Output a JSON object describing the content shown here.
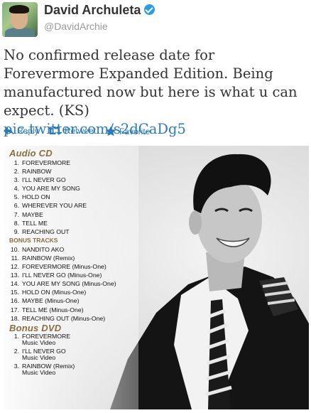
{
  "user": {
    "display_name": "David Archuleta",
    "handle": "@DavidArchie",
    "verified": true
  },
  "tweet": {
    "text": "No confirmed release date for Forevermore Expanded Edition. Being manufactured now but here is what u can expect. (KS)",
    "link": "pic.twitter.com/s2dCaDg5",
    "link_color": "#2b7bb9"
  },
  "actions": {
    "reply": "Reply",
    "retweet": "Retweet",
    "favorite": "Favorite"
  },
  "photo": {
    "audio_cd_title": "Audio CD",
    "audio_tracks": [
      {
        "num": "1.",
        "title": "FOREVERMORE"
      },
      {
        "num": "2.",
        "title": "RAINBOW"
      },
      {
        "num": "3.",
        "title": "I'LL NEVER GO"
      },
      {
        "num": "4.",
        "title": "YOU ARE MY SONG"
      },
      {
        "num": "5.",
        "title": "HOLD ON"
      },
      {
        "num": "6.",
        "title": "WHEREVER YOU ARE"
      },
      {
        "num": "7.",
        "title": "MAYBE"
      },
      {
        "num": "8.",
        "title": "TELL ME"
      },
      {
        "num": "9.",
        "title": "REACHING OUT"
      }
    ],
    "bonus_tracks_title": "BONUS TRACKS",
    "bonus_tracks": [
      {
        "num": "10.",
        "title": "NANDITO AKO"
      },
      {
        "num": "11.",
        "title": "RAINBOW (Remix)"
      },
      {
        "num": "12.",
        "title": "FOREVERMORE (Minus-One)"
      },
      {
        "num": "13.",
        "title": "I'LL NEVER GO (Minus-One)"
      },
      {
        "num": "14.",
        "title": "YOU ARE MY SONG (Minus-One)"
      },
      {
        "num": "15.",
        "title": "HOLD ON (Minus-One)"
      },
      {
        "num": "16.",
        "title": "MAYBE (Minus-One)"
      },
      {
        "num": "17.",
        "title": "TELL ME (Minus-One)"
      },
      {
        "num": "18.",
        "title": "REACHING OUT (Minus-One)"
      }
    ],
    "bonus_dvd_title": "Bonus DVD",
    "dvd_items": [
      {
        "num": "1.",
        "title": "FOREVERMORE",
        "sub": "Music Video"
      },
      {
        "num": "2.",
        "title": "I'LL NEVER GO",
        "sub": "Music Video"
      },
      {
        "num": "3.",
        "title": "RAINBOW (Remix)",
        "sub": "Music Video"
      }
    ]
  },
  "icons": {
    "verified": "verified-badge-icon",
    "reply": "reply-arrow-icon",
    "retweet": "retweet-icon",
    "favorite": "star-icon"
  }
}
